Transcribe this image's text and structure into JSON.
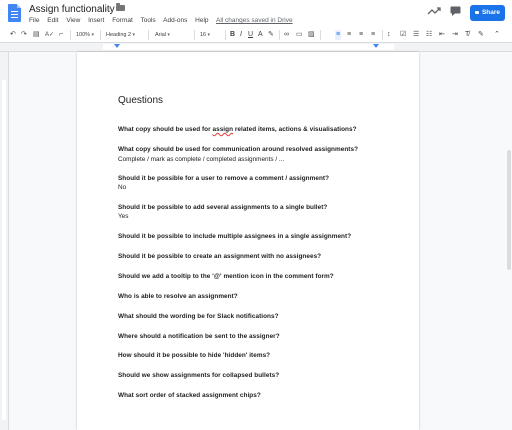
{
  "app": {
    "title": "Assign functionality",
    "menu": [
      "File",
      "Edit",
      "View",
      "Insert",
      "Format",
      "Tools",
      "Add-ons",
      "Help"
    ],
    "saved_status": "All changes saved in Drive",
    "share_label": "Share"
  },
  "toolbar": {
    "zoom": "100%",
    "style": "Heading 2",
    "font": "Arial",
    "size": "16"
  },
  "document": {
    "heading": "Questions",
    "q1": {
      "q": "What copy should be used for",
      "mid": "assign",
      "q_end": "related items, actions & visualisations?"
    },
    "q2": {
      "q": "What copy should be used for communication around resolved assignments?",
      "a": "Complete / mark as complete / completed assignments / ..."
    },
    "q3": {
      "q": "Should it be possible for a user to remove a comment / assignment?",
      "a": "No"
    },
    "q4": {
      "q": "Should it be possible to add several assignments to a single bullet?",
      "a": "Yes"
    },
    "q5": {
      "q": "Should it be possible to include multiple assignees in a single assignment?"
    },
    "q6": {
      "q": "Should it be possible to create an assignment with no assignees?"
    },
    "q7": {
      "q": "Should we add a tooltip to the '@' mention icon in the comment form?"
    },
    "q8": {
      "q": "Who is able to resolve an assignment?"
    },
    "q9": {
      "q": "What should the wording be for Slack notifications?"
    },
    "q10": {
      "q": "Where should a notification be sent to the assigner?"
    },
    "q11": {
      "q": "How should it be possible to hide 'hidden' items?"
    },
    "q12": {
      "q": "Should we show assignments for collapsed bullets?"
    },
    "q13": {
      "q": "What sort order of stacked assignment chips?"
    }
  },
  "icons": {
    "undo": "undo-icon",
    "redo": "redo-icon",
    "print": "print-icon",
    "spellcheck": "spellcheck-icon",
    "paint_format": "paint-format-icon",
    "trend": "activity-icon",
    "comments": "comments-icon"
  },
  "colors": {
    "accent": "#1a73e8",
    "doc_blue": "#4285f4"
  }
}
